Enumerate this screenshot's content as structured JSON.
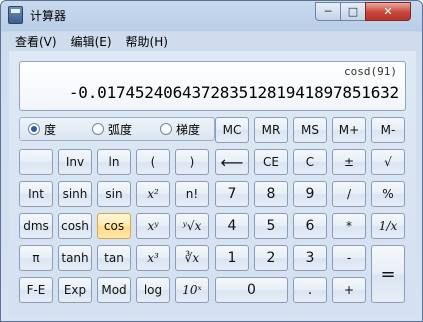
{
  "window": {
    "title": "计算器",
    "controls": {
      "minimize": "─",
      "maximize": "□",
      "close": "✕"
    }
  },
  "menu": [
    "查看(V)",
    "编辑(E)",
    "帮助(H)"
  ],
  "display": {
    "expression": "cosd(91)",
    "result": "-0.0174524064372835128194189785163 2"
  },
  "angle_modes": [
    {
      "label": "度",
      "selected": true
    },
    {
      "label": "弧度",
      "selected": false
    },
    {
      "label": "梯度",
      "selected": false
    }
  ],
  "buttons": {
    "mc": "MC",
    "mr": "MR",
    "ms": "MS",
    "mplus": "M+",
    "mminus": "M-",
    "blank": "",
    "inv": "Inv",
    "ln": "ln",
    "lparen": "(",
    "rparen": ")",
    "backspace": "⟵",
    "ce": "CE",
    "c": "C",
    "plusminus": "±",
    "sqrt": "√",
    "int": "Int",
    "sinh": "sinh",
    "sin": "sin",
    "x2": "x²",
    "nfact": "n!",
    "d7": "7",
    "d8": "8",
    "d9": "9",
    "div": "/",
    "pct": "%",
    "dms": "dms",
    "cosh": "cosh",
    "cos": "cos",
    "xy": "xʸ",
    "yroot": "ʸ√x",
    "d4": "4",
    "d5": "5",
    "d6": "6",
    "mul": "*",
    "recip": "1/x",
    "pi": "π",
    "tanh": "tanh",
    "tan": "tan",
    "x3": "x³",
    "cuberoot": "∛x",
    "d1": "1",
    "d2": "2",
    "d3": "3",
    "sub": "-",
    "eq": "=",
    "fe": "F-E",
    "exp": "Exp",
    "mod": "Mod",
    "log": "log",
    "tenx": "10ˣ",
    "d0": "0",
    "dot": ".",
    "add": "+"
  }
}
